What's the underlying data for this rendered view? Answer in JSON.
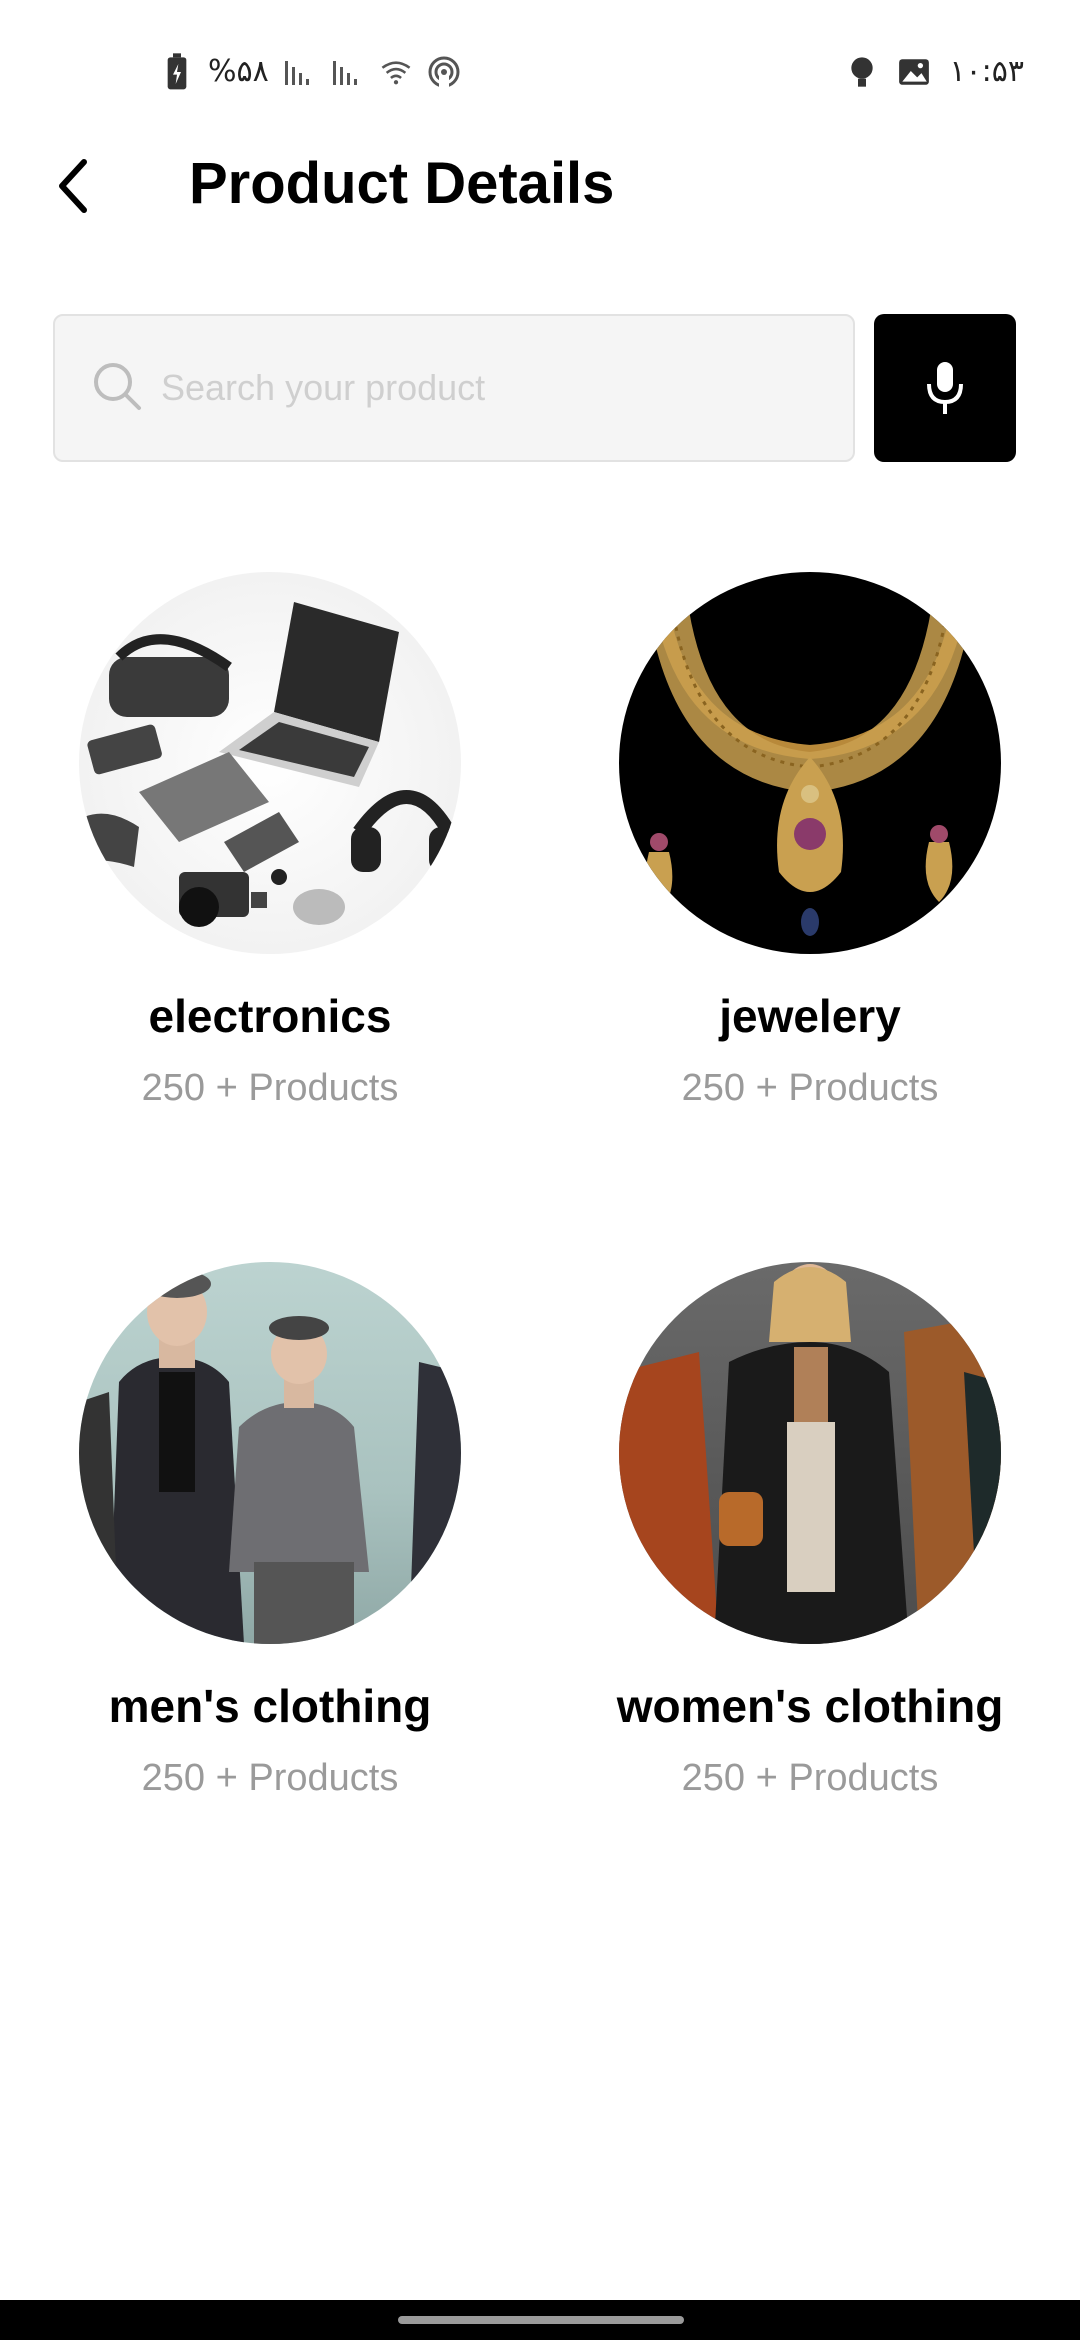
{
  "status_bar": {
    "battery_text": "%۵۸",
    "time": "۱۰:۵۳",
    "icons": [
      "battery-icon",
      "signal-icon",
      "signal-icon",
      "wifi-icon",
      "hotspot-icon",
      "notification-icon",
      "gallery-icon"
    ]
  },
  "header": {
    "back_icon": "back-arrow-icon",
    "title": "Product Details"
  },
  "search": {
    "placeholder": "Search your product",
    "value": "",
    "mic_icon": "microphone-icon"
  },
  "categories": [
    {
      "name": "electronics",
      "count": "250 + Products",
      "image": "electronics-image"
    },
    {
      "name": "jewelery",
      "count": "250 + Products",
      "image": "jewelery-image"
    },
    {
      "name": "men's clothing",
      "count": "250 + Products",
      "image": "mens-clothing-image"
    },
    {
      "name": "women's clothing",
      "count": "250 + Products",
      "image": "womens-clothing-image"
    }
  ],
  "colors": {
    "background": "#ffffff",
    "title": "#000000",
    "muted_text": "#9a9a9a",
    "search_bg": "#f5f5f5",
    "mic_bg": "#000000"
  }
}
